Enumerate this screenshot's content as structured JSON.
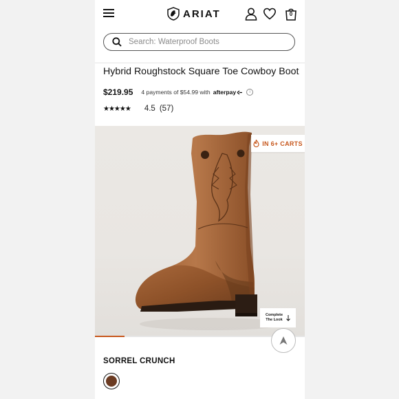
{
  "header": {
    "brand": "ARIAT",
    "cart_count": "0"
  },
  "search": {
    "placeholder": "Search: Waterproof Boots"
  },
  "product": {
    "title": "Hybrid Roughstock Square Toe Cowboy Boot",
    "price": "$219.95",
    "payments_text": "4 payments of $54.99 with",
    "afterpay_label": "afterpay",
    "stars": "★★★★★",
    "rating": "4.5",
    "review_count": "(57)"
  },
  "hero": {
    "badge_text": "IN 6+ CARTS",
    "complete_look_label": "Complete\nThe Look",
    "carousel_position": 0.14
  },
  "variant": {
    "color_name": "SORREL CRUNCH",
    "swatch_color": "#6b3b22"
  },
  "colors": {
    "accent": "#c7571c",
    "text": "#111111",
    "hero_bg": "#ebe8e4"
  }
}
